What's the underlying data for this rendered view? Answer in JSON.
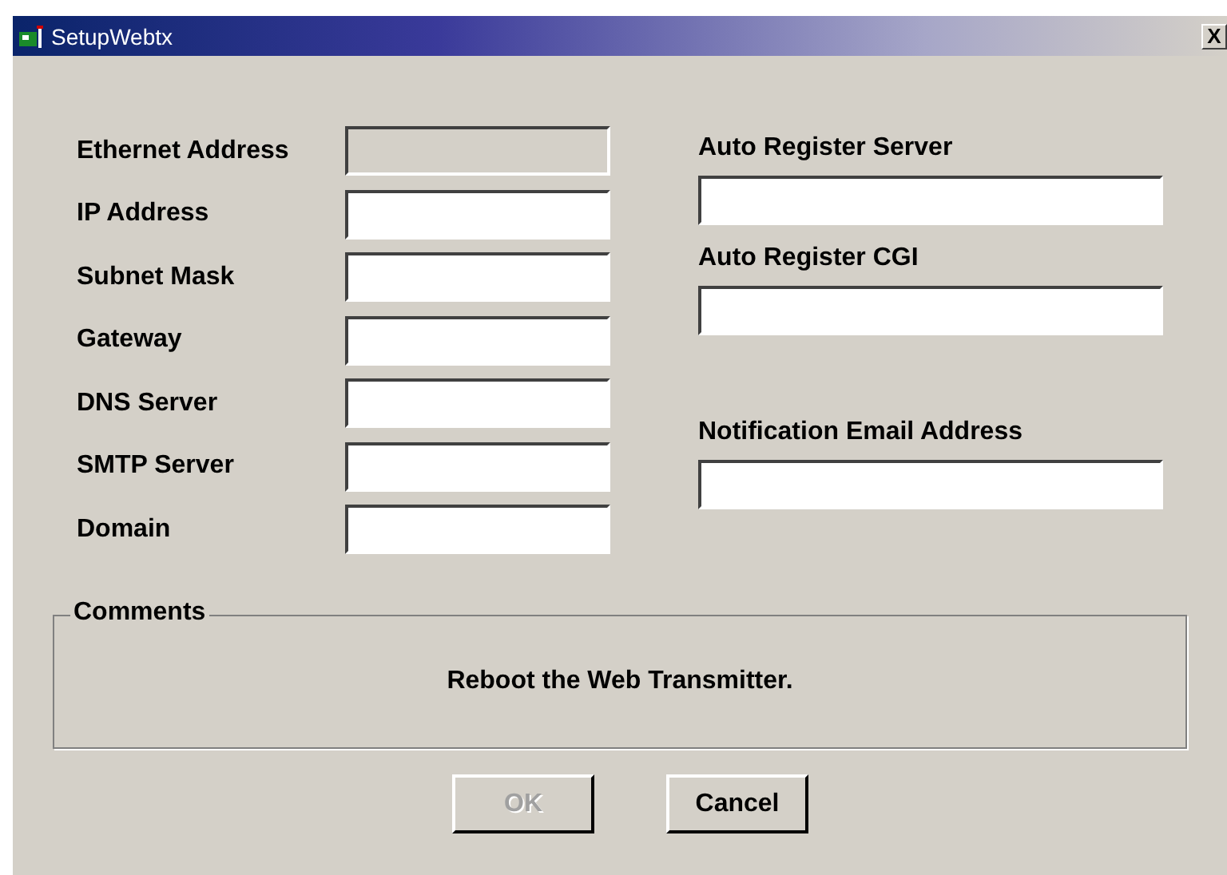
{
  "window": {
    "title": "SetupWebtx",
    "close": "X"
  },
  "left_fields": [
    {
      "label": "Ethernet Address",
      "disabled": true
    },
    {
      "label": "IP Address",
      "disabled": false
    },
    {
      "label": "Subnet Mask",
      "disabled": false
    },
    {
      "label": "Gateway",
      "disabled": false
    },
    {
      "label": "DNS Server",
      "disabled": false
    },
    {
      "label": "SMTP Server",
      "disabled": false
    },
    {
      "label": "Domain",
      "disabled": false
    }
  ],
  "right_fields": [
    {
      "label": "Auto Register Server"
    },
    {
      "label": "Auto Register CGI"
    },
    {
      "label": "Notification Email Address"
    }
  ],
  "comments": {
    "title": "Comments",
    "text": "Reboot the Web Transmitter."
  },
  "buttons": [
    {
      "label": "OK",
      "disabled": true
    },
    {
      "label": "Cancel",
      "disabled": false
    }
  ]
}
